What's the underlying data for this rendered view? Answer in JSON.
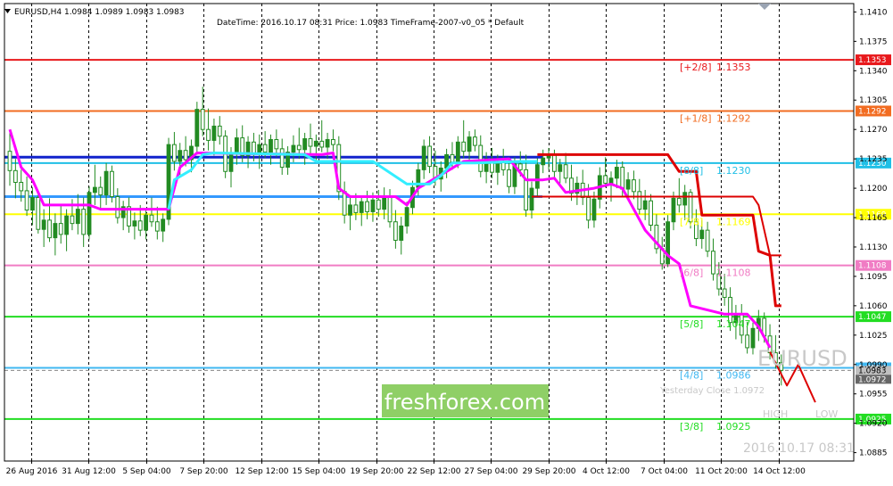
{
  "header": {
    "symbol_line": "EURUSD,H4  1.0984 1.0989 1.0983 1.0983",
    "info_line": "DateTime: 2016.10.17 08:31    Price: 1.0983    TimeFrame-2007-v0_05    *    Default"
  },
  "watermark": {
    "text": "freshforex.com",
    "background": "#8fcf66"
  },
  "overlay": {
    "symbol": "EURUSD",
    "datetime": "2016.10.17 08:31",
    "high_label": "HIGH",
    "low_label": "LOW",
    "yesterday_close": "Yesterday Close 1.0972"
  },
  "colors": {
    "background": "#ffffff",
    "candle": "#228b22",
    "grid": "#000000",
    "magenta": "#ff00ff",
    "cyan": "#33eeff",
    "red_step": "#dd0000"
  },
  "chart_data": {
    "type": "line",
    "ylim": [
      1.0875,
      1.142
    ],
    "price_ticks": [
      "1.1410",
      "1.1375",
      "1.1340",
      "1.1305",
      "1.1270",
      "1.1235",
      "1.1200",
      "1.1165",
      "1.1130",
      "1.1095",
      "1.1060",
      "1.1025",
      "1.0990",
      "1.0955",
      "1.0920",
      "1.0885"
    ],
    "time_ticks": [
      "26 Aug 2016",
      "31 Aug 12:00",
      "5 Sep 04:00",
      "7 Sep 20:00",
      "12 Sep 12:00",
      "15 Sep 04:00",
      "19 Sep 20:00",
      "22 Sep 12:00",
      "27 Sep 04:00",
      "29 Sep 20:00",
      "4 Oct 12:00",
      "7 Oct 04:00",
      "11 Oct 20:00",
      "14 Oct 12:00"
    ],
    "murrey_levels": [
      {
        "label": "[+2/8]",
        "value": "1.1353",
        "color": "#e8191c"
      },
      {
        "label": "[+1/8]",
        "value": "1.1292",
        "color": "#f26c21"
      },
      {
        "label": "[8/8]",
        "value": "1.1230",
        "color": "#1fbfe6"
      },
      {
        "label": "[7/8]",
        "value": "1.1169",
        "color": "#ffff00"
      },
      {
        "label": "[6/8]",
        "value": "1.1108",
        "color": "#f07cc4"
      },
      {
        "label": "[5/8]",
        "value": "1.1047",
        "color": "#22dd22"
      },
      {
        "label": "[4/8]",
        "value": "1.0986",
        "color": "#40b8f2"
      },
      {
        "label": "[3/8]",
        "value": "1.0925",
        "color": "#22dd22"
      }
    ],
    "extra_levels": [
      {
        "value": 1.1237,
        "color": "#1122cc"
      },
      {
        "value": 1.119,
        "color": "#3399ff"
      }
    ],
    "current_price": {
      "value": "1.0983",
      "color": "#c0c0c0"
    },
    "yesterday_close_badge": {
      "value": "1.0972",
      "color": "#666666"
    },
    "candles": [
      [
        1.1244,
        1.1266,
        1.1203,
        1.1221
      ],
      [
        1.1221,
        1.1235,
        1.1188,
        1.1207
      ],
      [
        1.1207,
        1.1222,
        1.1184,
        1.1197
      ],
      [
        1.1197,
        1.1214,
        1.1167,
        1.1174
      ],
      [
        1.1174,
        1.1201,
        1.1156,
        1.1189
      ],
      [
        1.1189,
        1.1194,
        1.1146,
        1.1151
      ],
      [
        1.1151,
        1.1175,
        1.113,
        1.1162
      ],
      [
        1.1162,
        1.1188,
        1.1136,
        1.1141
      ],
      [
        1.1141,
        1.117,
        1.112,
        1.1158
      ],
      [
        1.1158,
        1.1179,
        1.1134,
        1.1145
      ],
      [
        1.1145,
        1.1175,
        1.1125,
        1.1167
      ],
      [
        1.1167,
        1.1187,
        1.115,
        1.1158
      ],
      [
        1.1158,
        1.1193,
        1.1145,
        1.1175
      ],
      [
        1.1175,
        1.1189,
        1.113,
        1.1145
      ],
      [
        1.1145,
        1.1202,
        1.1139,
        1.1195
      ],
      [
        1.1195,
        1.1228,
        1.118,
        1.1201
      ],
      [
        1.1201,
        1.1214,
        1.1176,
        1.1192
      ],
      [
        1.1192,
        1.123,
        1.118,
        1.122
      ],
      [
        1.122,
        1.1227,
        1.1183,
        1.119
      ],
      [
        1.119,
        1.12,
        1.1158,
        1.1165
      ],
      [
        1.1165,
        1.1185,
        1.115,
        1.1178
      ],
      [
        1.1178,
        1.1189,
        1.1147,
        1.1155
      ],
      [
        1.1155,
        1.1171,
        1.1139,
        1.1161
      ],
      [
        1.1161,
        1.118,
        1.1143,
        1.115
      ],
      [
        1.115,
        1.1175,
        1.1139,
        1.1168
      ],
      [
        1.1168,
        1.1189,
        1.1154,
        1.116
      ],
      [
        1.116,
        1.1178,
        1.1139,
        1.1149
      ],
      [
        1.1149,
        1.117,
        1.1136,
        1.1163
      ],
      [
        1.1163,
        1.126,
        1.1156,
        1.1252
      ],
      [
        1.1252,
        1.1267,
        1.1221,
        1.1232
      ],
      [
        1.1232,
        1.1254,
        1.1216,
        1.1245
      ],
      [
        1.1245,
        1.1262,
        1.1226,
        1.1234
      ],
      [
        1.1234,
        1.1258,
        1.1219,
        1.125
      ],
      [
        1.125,
        1.1303,
        1.124,
        1.1294
      ],
      [
        1.1294,
        1.1321,
        1.1262,
        1.127
      ],
      [
        1.127,
        1.1295,
        1.1245,
        1.1257
      ],
      [
        1.1257,
        1.1283,
        1.1239,
        1.1274
      ],
      [
        1.1274,
        1.1286,
        1.1252,
        1.1262
      ],
      [
        1.1262,
        1.1269,
        1.1212,
        1.122
      ],
      [
        1.122,
        1.1249,
        1.1201,
        1.1241
      ],
      [
        1.1241,
        1.1271,
        1.1228,
        1.126
      ],
      [
        1.126,
        1.1275,
        1.1231,
        1.1239
      ],
      [
        1.1239,
        1.1262,
        1.1224,
        1.1255
      ],
      [
        1.1255,
        1.1266,
        1.1232,
        1.1241
      ],
      [
        1.1241,
        1.1264,
        1.1223,
        1.1252
      ],
      [
        1.1252,
        1.1268,
        1.1236,
        1.1243
      ],
      [
        1.1243,
        1.1264,
        1.1228,
        1.1258
      ],
      [
        1.1258,
        1.127,
        1.1237,
        1.1247
      ],
      [
        1.1247,
        1.1259,
        1.1216,
        1.1225
      ],
      [
        1.1225,
        1.125,
        1.1216,
        1.1243
      ],
      [
        1.1243,
        1.1263,
        1.1231,
        1.1251
      ],
      [
        1.1251,
        1.1272,
        1.1235,
        1.1246
      ],
      [
        1.1246,
        1.1266,
        1.1228,
        1.1259
      ],
      [
        1.1259,
        1.1277,
        1.1241,
        1.125
      ],
      [
        1.125,
        1.1264,
        1.1232,
        1.1256
      ],
      [
        1.1256,
        1.1281,
        1.1243,
        1.1249
      ],
      [
        1.1249,
        1.1266,
        1.1235,
        1.1258
      ],
      [
        1.1258,
        1.127,
        1.1244,
        1.1252
      ],
      [
        1.1252,
        1.1262,
        1.1186,
        1.1196
      ],
      [
        1.1196,
        1.1208,
        1.1158,
        1.1168
      ],
      [
        1.1168,
        1.1189,
        1.115,
        1.118
      ],
      [
        1.118,
        1.1194,
        1.1162,
        1.1171
      ],
      [
        1.1171,
        1.119,
        1.1155,
        1.1184
      ],
      [
        1.1184,
        1.1197,
        1.1163,
        1.1172
      ],
      [
        1.1172,
        1.1195,
        1.116,
        1.1186
      ],
      [
        1.1186,
        1.1198,
        1.1166,
        1.1175
      ],
      [
        1.1175,
        1.1201,
        1.1163,
        1.119
      ],
      [
        1.119,
        1.1199,
        1.1153,
        1.116
      ],
      [
        1.116,
        1.1174,
        1.1128,
        1.1138
      ],
      [
        1.1138,
        1.1166,
        1.1121,
        1.1155
      ],
      [
        1.1155,
        1.1184,
        1.1146,
        1.1177
      ],
      [
        1.1177,
        1.1209,
        1.1169,
        1.1201
      ],
      [
        1.1201,
        1.123,
        1.1191,
        1.1222
      ],
      [
        1.1222,
        1.1258,
        1.1211,
        1.125
      ],
      [
        1.125,
        1.1262,
        1.1218,
        1.1226
      ],
      [
        1.1226,
        1.1245,
        1.1203,
        1.1211
      ],
      [
        1.1211,
        1.1232,
        1.1196,
        1.1224
      ],
      [
        1.1224,
        1.1247,
        1.1212,
        1.124
      ],
      [
        1.124,
        1.1255,
        1.1222,
        1.1231
      ],
      [
        1.1231,
        1.1262,
        1.1224,
        1.1255
      ],
      [
        1.1255,
        1.1281,
        1.1236,
        1.1244
      ],
      [
        1.1244,
        1.1268,
        1.123,
        1.1261
      ],
      [
        1.1261,
        1.127,
        1.1244,
        1.1251
      ],
      [
        1.1251,
        1.1263,
        1.1213,
        1.122
      ],
      [
        1.122,
        1.1243,
        1.1206,
        1.1235
      ],
      [
        1.1235,
        1.1248,
        1.1212,
        1.1219
      ],
      [
        1.1219,
        1.124,
        1.1204,
        1.1231
      ],
      [
        1.1231,
        1.1247,
        1.1215,
        1.1222
      ],
      [
        1.1222,
        1.1237,
        1.1194,
        1.1202
      ],
      [
        1.1202,
        1.1237,
        1.1193,
        1.1229
      ],
      [
        1.1229,
        1.1244,
        1.1214,
        1.1222
      ],
      [
        1.1222,
        1.124,
        1.1166,
        1.1174
      ],
      [
        1.1174,
        1.1208,
        1.1164,
        1.12
      ],
      [
        1.12,
        1.1236,
        1.1191,
        1.1228
      ],
      [
        1.1228,
        1.1246,
        1.1218,
        1.1236
      ],
      [
        1.1236,
        1.1248,
        1.1222,
        1.124
      ],
      [
        1.124,
        1.1246,
        1.1213,
        1.122
      ],
      [
        1.122,
        1.1235,
        1.1206,
        1.1228
      ],
      [
        1.1228,
        1.1242,
        1.1206,
        1.1212
      ],
      [
        1.1212,
        1.1228,
        1.1185,
        1.1194
      ],
      [
        1.1194,
        1.1214,
        1.118,
        1.1206
      ],
      [
        1.1206,
        1.1222,
        1.118,
        1.1189
      ],
      [
        1.1189,
        1.1205,
        1.1152,
        1.1162
      ],
      [
        1.1162,
        1.1196,
        1.1153,
        1.1187
      ],
      [
        1.1187,
        1.1225,
        1.1176,
        1.1215
      ],
      [
        1.1215,
        1.1237,
        1.1201,
        1.1206
      ],
      [
        1.1206,
        1.122,
        1.1184,
        1.1212
      ],
      [
        1.1212,
        1.1234,
        1.12,
        1.1225
      ],
      [
        1.1225,
        1.1232,
        1.1191,
        1.1199
      ],
      [
        1.1199,
        1.1219,
        1.1185,
        1.121
      ],
      [
        1.121,
        1.1221,
        1.1187,
        1.1196
      ],
      [
        1.1196,
        1.1211,
        1.1169,
        1.1175
      ],
      [
        1.1175,
        1.1198,
        1.1162,
        1.1185
      ],
      [
        1.1185,
        1.1193,
        1.1149,
        1.1156
      ],
      [
        1.1156,
        1.1169,
        1.1122,
        1.1128
      ],
      [
        1.1128,
        1.1142,
        1.1103,
        1.111
      ],
      [
        1.111,
        1.1168,
        1.1106,
        1.116
      ],
      [
        1.116,
        1.1196,
        1.115,
        1.1188
      ],
      [
        1.1188,
        1.1212,
        1.1171,
        1.118
      ],
      [
        1.118,
        1.1204,
        1.1162,
        1.1195
      ],
      [
        1.1195,
        1.1199,
        1.1152,
        1.116
      ],
      [
        1.116,
        1.1175,
        1.1131,
        1.114
      ],
      [
        1.114,
        1.1162,
        1.1128,
        1.115
      ],
      [
        1.115,
        1.116,
        1.1118,
        1.1125
      ],
      [
        1.1125,
        1.114,
        1.109,
        1.1098
      ],
      [
        1.1098,
        1.1112,
        1.1072,
        1.108
      ],
      [
        1.108,
        1.1098,
        1.106,
        1.107
      ],
      [
        1.107,
        1.1082,
        1.103,
        1.104
      ],
      [
        1.104,
        1.1061,
        1.102,
        1.105
      ],
      [
        1.105,
        1.1062,
        1.1015,
        1.1025
      ],
      [
        1.1025,
        1.1041,
        1.1003,
        1.101
      ],
      [
        1.101,
        1.104,
        1.1002,
        1.1033
      ],
      [
        1.1033,
        1.1055,
        1.1018,
        1.1045
      ],
      [
        1.1045,
        1.1052,
        1.1016,
        1.1024
      ],
      [
        1.1024,
        1.1038,
        1.0996,
        1.1004
      ],
      [
        1.1004,
        1.1025,
        1.0985,
        1.0992
      ],
      [
        1.0992,
        1.1002,
        1.0965,
        1.0983
      ]
    ],
    "magenta_line": [
      [
        0,
        1.127
      ],
      [
        2,
        1.1225
      ],
      [
        4,
        1.121
      ],
      [
        6,
        1.118
      ],
      [
        14,
        1.118
      ],
      [
        16,
        1.1175
      ],
      [
        28,
        1.1175
      ],
      [
        30,
        1.1225
      ],
      [
        33,
        1.1242
      ],
      [
        55,
        1.124
      ],
      [
        57,
        1.1242
      ],
      [
        58,
        1.12
      ],
      [
        60,
        1.119
      ],
      [
        68,
        1.119
      ],
      [
        70,
        1.118
      ],
      [
        72,
        1.12
      ],
      [
        80,
        1.1232
      ],
      [
        88,
        1.1235
      ],
      [
        91,
        1.121
      ],
      [
        94,
        1.121
      ],
      [
        96,
        1.1212
      ],
      [
        98,
        1.1195
      ],
      [
        103,
        1.12
      ],
      [
        106,
        1.1205
      ],
      [
        108,
        1.12
      ],
      [
        112,
        1.115
      ],
      [
        116,
        1.112
      ],
      [
        118,
        1.111
      ],
      [
        120,
        1.106
      ],
      [
        126,
        1.105
      ],
      [
        130,
        1.105
      ],
      [
        132,
        1.1035
      ],
      [
        134,
        1.101
      ]
    ],
    "cyan_line": [
      [
        28,
        1.1175
      ],
      [
        29,
        1.121
      ],
      [
        32,
        1.1222
      ],
      [
        34,
        1.124
      ],
      [
        36,
        1.1242
      ],
      [
        52,
        1.124
      ],
      [
        54,
        1.1232
      ],
      [
        60,
        1.1232
      ],
      [
        64,
        1.1232
      ],
      [
        70,
        1.1205
      ],
      [
        74,
        1.1205
      ],
      [
        76,
        1.1215
      ],
      [
        78,
        1.123
      ],
      [
        82,
        1.123
      ],
      [
        90,
        1.1232
      ],
      [
        93,
        1.1232
      ]
    ],
    "red_step_line": [
      [
        93,
        1.124
      ],
      [
        116,
        1.124
      ],
      [
        118,
        1.122
      ],
      [
        121,
        1.122
      ],
      [
        122,
        1.1168
      ],
      [
        131,
        1.1168
      ],
      [
        132,
        1.1125
      ],
      [
        134,
        1.112
      ],
      [
        135,
        1.106
      ],
      [
        136,
        1.106
      ]
    ],
    "red_step_line_lower": [
      [
        92,
        1.119
      ],
      [
        131,
        1.119
      ],
      [
        132,
        1.118
      ],
      [
        134,
        1.112
      ],
      [
        136,
        1.112
      ]
    ],
    "red_projection": [
      [
        134,
        1.1005
      ],
      [
        137,
        1.0965
      ],
      [
        139,
        1.099
      ],
      [
        142,
        1.0945
      ]
    ]
  }
}
